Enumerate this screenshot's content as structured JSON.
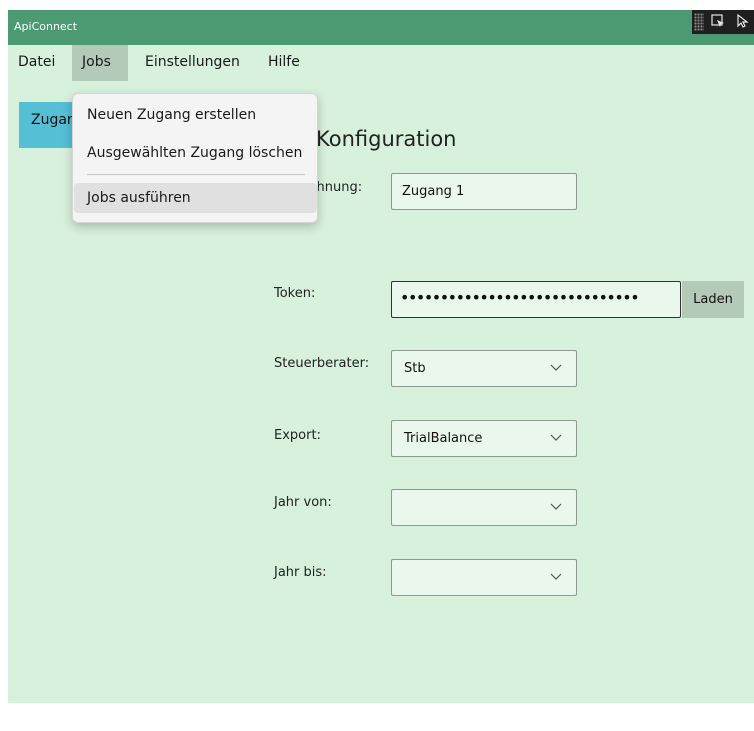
{
  "window": {
    "title": "ApiConnect"
  },
  "colors": {
    "background": "#d7f1dc",
    "titlebar": "#4b9a72",
    "accent_button": "#54bfd5",
    "menu_active": "#b5c9b9"
  },
  "menubar": {
    "items": [
      "Datei",
      "Jobs",
      "Einstellungen",
      "Hilfe"
    ],
    "active": "Jobs"
  },
  "jobs_menu": {
    "items": [
      "Neuen Zugang erstellen",
      "Ausgewählten Zugang löschen",
      "Jobs ausführen"
    ],
    "hovered": "Jobs ausführen"
  },
  "sidebar": {
    "button_label": "Zugang 1"
  },
  "main": {
    "heading": "Konfiguration",
    "bezeichnung": {
      "label": "Bezeichnung:",
      "value": "Zugang 1"
    },
    "token": {
      "label": "Token:",
      "value": "••••••••••••••••••••••••••••••",
      "load_button": "Laden"
    },
    "steuerberater": {
      "label": "Steuerberater:",
      "value": "Stb"
    },
    "export": {
      "label": "Export:",
      "value": "TrialBalance"
    },
    "jahr_von": {
      "label": "Jahr von:",
      "value": ""
    },
    "jahr_bis": {
      "label": "Jahr bis:",
      "value": ""
    }
  },
  "icons": {
    "chevron": "chevron-down-icon",
    "debug_select": "select-element-icon",
    "debug_pointer": "pointer-icon"
  }
}
